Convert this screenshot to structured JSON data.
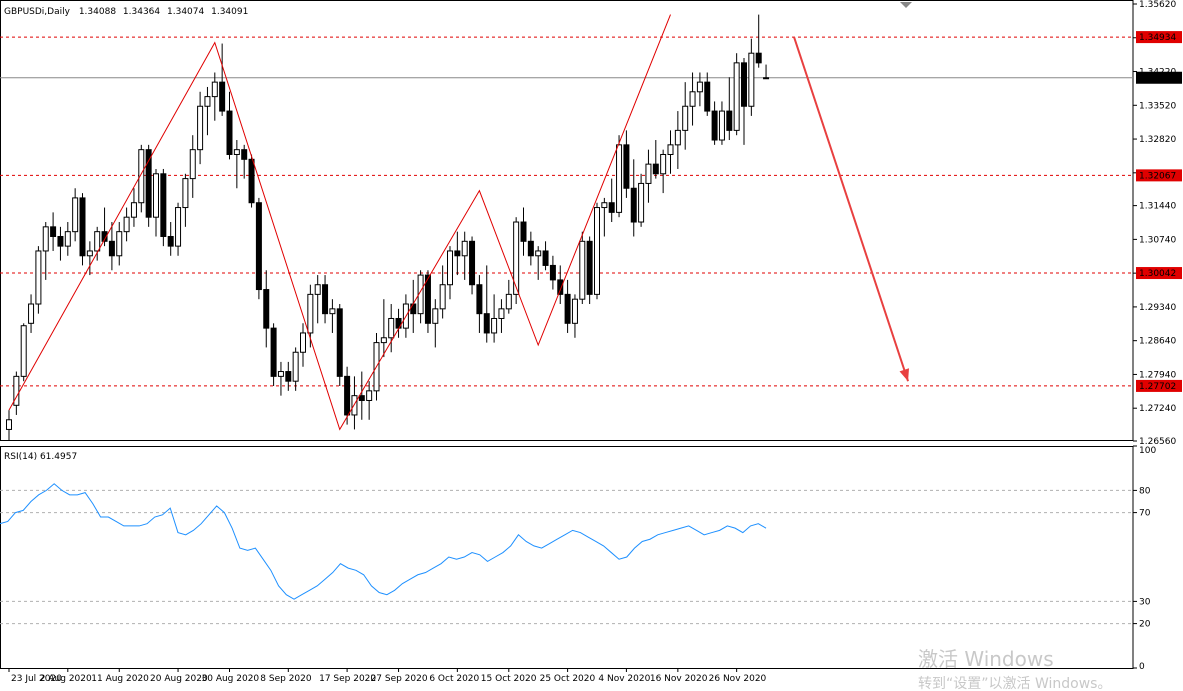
{
  "header": {
    "symbol": "GBPUSDi,Daily",
    "open": "1.34088",
    "high": "1.34364",
    "low": "1.34074",
    "close": "1.34091"
  },
  "rsi_panel": {
    "label": "RSI(14) 61.4957"
  },
  "watermark": {
    "line1": "激活 Windows",
    "line2": "转到“设置”以激活 Windows。"
  },
  "colors": {
    "bull": "#ffffff",
    "bear": "#000000",
    "level_line": "#e00000",
    "zigzag": "#e00000",
    "arrow": "#e84040",
    "rsi": "#1e90ff",
    "current_price_bg": "#000000",
    "level_bg": "#e00000"
  },
  "chart_data": [
    {
      "type": "candlestick",
      "title": "GBPUSDi,Daily",
      "ylim": [
        1.2656,
        1.3562
      ],
      "y_ticks": [
        "1.35620",
        "1.34920",
        "1.34220",
        "1.33520",
        "1.32820",
        "1.32120",
        "1.31440",
        "1.30740",
        "1.30040",
        "1.29340",
        "1.28640",
        "1.27940",
        "1.27240",
        "1.26560"
      ],
      "x_ticks": [
        "23 Jul 2020",
        "2 Aug 2020",
        "11 Aug 2020",
        "20 Aug 2020",
        "30 Aug 2020",
        "8 Sep 2020",
        "17 Sep 2020",
        "27 Sep 2020",
        "6 Oct 2020",
        "15 Oct 2020",
        "25 Oct 2020",
        "4 Nov 2020",
        "16 Nov 2020",
        "26 Nov 2020"
      ],
      "levels": [
        {
          "label": "1.34934",
          "value": 1.34934
        },
        {
          "label": "1.32067",
          "value": 1.32067
        },
        {
          "label": "1.30042",
          "value": 1.30042
        },
        {
          "label": "1.27702",
          "value": 1.27702
        }
      ],
      "current_price": {
        "label": "1.34091",
        "value": 1.34091
      },
      "candles": [
        [
          1.268,
          1.272,
          1.2656,
          1.27
        ],
        [
          1.273,
          1.28,
          1.271,
          1.279
        ],
        [
          1.279,
          1.29,
          1.278,
          1.2895
        ],
        [
          1.29,
          1.296,
          1.288,
          1.294
        ],
        [
          1.294,
          1.306,
          1.292,
          1.305
        ],
        [
          1.305,
          1.311,
          1.299,
          1.31
        ],
        [
          1.31,
          1.313,
          1.305,
          1.308
        ],
        [
          1.308,
          1.31,
          1.303,
          1.306
        ],
        [
          1.306,
          1.311,
          1.304,
          1.309
        ],
        [
          1.309,
          1.318,
          1.307,
          1.316
        ],
        [
          1.316,
          1.317,
          1.302,
          1.304
        ],
        [
          1.304,
          1.307,
          1.3,
          1.305
        ],
        [
          1.305,
          1.31,
          1.303,
          1.309
        ],
        [
          1.309,
          1.314,
          1.306,
          1.307
        ],
        [
          1.307,
          1.311,
          1.301,
          1.304
        ],
        [
          1.304,
          1.311,
          1.302,
          1.309
        ],
        [
          1.309,
          1.314,
          1.307,
          1.312
        ],
        [
          1.312,
          1.318,
          1.31,
          1.315
        ],
        [
          1.315,
          1.327,
          1.313,
          1.326
        ],
        [
          1.326,
          1.327,
          1.31,
          1.312
        ],
        [
          1.312,
          1.322,
          1.308,
          1.321
        ],
        [
          1.321,
          1.322,
          1.306,
          1.308
        ],
        [
          1.308,
          1.311,
          1.304,
          1.306
        ],
        [
          1.306,
          1.315,
          1.304,
          1.314
        ],
        [
          1.314,
          1.321,
          1.31,
          1.32
        ],
        [
          1.32,
          1.329,
          1.316,
          1.326
        ],
        [
          1.326,
          1.338,
          1.323,
          1.335
        ],
        [
          1.335,
          1.339,
          1.329,
          1.337
        ],
        [
          1.337,
          1.342,
          1.332,
          1.34
        ],
        [
          1.34,
          1.348,
          1.333,
          1.334
        ],
        [
          1.334,
          1.338,
          1.324,
          1.325
        ],
        [
          1.325,
          1.328,
          1.318,
          1.326
        ],
        [
          1.326,
          1.327,
          1.32,
          1.324
        ],
        [
          1.324,
          1.325,
          1.314,
          1.315
        ],
        [
          1.315,
          1.316,
          1.295,
          1.297
        ],
        [
          1.297,
          1.301,
          1.285,
          1.289
        ],
        [
          1.289,
          1.29,
          1.277,
          1.279
        ],
        [
          1.279,
          1.282,
          1.275,
          1.28
        ],
        [
          1.28,
          1.282,
          1.276,
          1.278
        ],
        [
          1.278,
          1.285,
          1.276,
          1.284
        ],
        [
          1.284,
          1.29,
          1.281,
          1.288
        ],
        [
          1.288,
          1.298,
          1.285,
          1.296
        ],
        [
          1.296,
          1.3,
          1.29,
          1.298
        ],
        [
          1.298,
          1.3,
          1.29,
          1.292
        ],
        [
          1.292,
          1.295,
          1.288,
          1.293
        ],
        [
          1.293,
          1.294,
          1.277,
          1.279
        ],
        [
          1.279,
          1.281,
          1.269,
          1.271
        ],
        [
          1.271,
          1.279,
          1.268,
          1.275
        ],
        [
          1.275,
          1.28,
          1.27,
          1.274
        ],
        [
          1.274,
          1.278,
          1.27,
          1.276
        ],
        [
          1.276,
          1.288,
          1.274,
          1.286
        ],
        [
          1.286,
          1.295,
          1.283,
          1.287
        ],
        [
          1.287,
          1.294,
          1.284,
          1.291
        ],
        [
          1.291,
          1.293,
          1.287,
          1.289
        ],
        [
          1.289,
          1.296,
          1.287,
          1.294
        ],
        [
          1.294,
          1.299,
          1.288,
          1.292
        ],
        [
          1.292,
          1.301,
          1.29,
          1.3
        ],
        [
          1.3,
          1.301,
          1.288,
          1.29
        ],
        [
          1.29,
          1.295,
          1.285,
          1.293
        ],
        [
          1.293,
          1.302,
          1.291,
          1.298
        ],
        [
          1.298,
          1.306,
          1.295,
          1.305
        ],
        [
          1.305,
          1.309,
          1.3,
          1.304
        ],
        [
          1.304,
          1.309,
          1.299,
          1.307
        ],
        [
          1.307,
          1.308,
          1.296,
          1.298
        ],
        [
          1.298,
          1.3,
          1.288,
          1.292
        ],
        [
          1.292,
          1.302,
          1.286,
          1.288
        ],
        [
          1.288,
          1.296,
          1.286,
          1.291
        ],
        [
          1.291,
          1.295,
          1.288,
          1.293
        ],
        [
          1.293,
          1.299,
          1.292,
          1.296
        ],
        [
          1.296,
          1.312,
          1.294,
          1.311
        ],
        [
          1.311,
          1.314,
          1.304,
          1.307
        ],
        [
          1.307,
          1.309,
          1.302,
          1.304
        ],
        [
          1.304,
          1.306,
          1.299,
          1.305
        ],
        [
          1.305,
          1.307,
          1.301,
          1.302
        ],
        [
          1.302,
          1.304,
          1.297,
          1.299
        ],
        [
          1.299,
          1.302,
          1.294,
          1.296
        ],
        [
          1.296,
          1.299,
          1.288,
          1.29
        ],
        [
          1.29,
          1.296,
          1.287,
          1.295
        ],
        [
          1.295,
          1.309,
          1.294,
          1.307
        ],
        [
          1.307,
          1.308,
          1.294,
          1.296
        ],
        [
          1.296,
          1.315,
          1.295,
          1.314
        ],
        [
          1.314,
          1.316,
          1.308,
          1.315
        ],
        [
          1.315,
          1.32,
          1.311,
          1.313
        ],
        [
          1.313,
          1.329,
          1.312,
          1.327
        ],
        [
          1.327,
          1.33,
          1.316,
          1.318
        ],
        [
          1.318,
          1.324,
          1.308,
          1.311
        ],
        [
          1.311,
          1.321,
          1.31,
          1.319
        ],
        [
          1.319,
          1.326,
          1.315,
          1.323
        ],
        [
          1.323,
          1.328,
          1.32,
          1.321
        ],
        [
          1.321,
          1.326,
          1.317,
          1.325
        ],
        [
          1.325,
          1.33,
          1.321,
          1.327
        ],
        [
          1.327,
          1.334,
          1.322,
          1.33
        ],
        [
          1.33,
          1.34,
          1.326,
          1.335
        ],
        [
          1.335,
          1.342,
          1.331,
          1.338
        ],
        [
          1.338,
          1.342,
          1.335,
          1.34
        ],
        [
          1.34,
          1.342,
          1.333,
          1.334
        ],
        [
          1.334,
          1.336,
          1.327,
          1.328
        ],
        [
          1.328,
          1.336,
          1.327,
          1.334
        ],
        [
          1.334,
          1.341,
          1.328,
          1.33
        ],
        [
          1.33,
          1.346,
          1.329,
          1.344
        ],
        [
          1.344,
          1.345,
          1.327,
          1.335
        ],
        [
          1.335,
          1.349,
          1.333,
          1.346
        ],
        [
          1.346,
          1.354,
          1.343,
          1.344
        ],
        [
          1.34088,
          1.34364,
          1.34074,
          1.34091
        ]
      ],
      "zigzag": [
        [
          0,
          1.272
        ],
        [
          28,
          1.3482
        ],
        [
          45,
          1.268
        ],
        [
          64,
          1.3175
        ],
        [
          72,
          1.2855
        ],
        [
          90,
          1.354
        ]
      ],
      "forecast_arrow": {
        "from": 1.34934,
        "to": 1.278
      }
    },
    {
      "type": "line",
      "title": "RSI(14) 61.4957",
      "ylim": [
        0,
        100
      ],
      "y_ticks": [
        "100",
        "80",
        "70",
        "30",
        "20",
        "0"
      ],
      "levels": [
        80,
        70,
        30,
        20
      ],
      "series": [
        {
          "values": [
            65,
            66,
            70,
            71,
            75,
            78,
            80,
            83,
            80,
            78,
            78,
            79,
            74,
            68,
            68,
            66,
            64,
            64,
            64,
            65,
            68,
            69,
            72,
            61,
            60,
            62,
            65,
            69,
            73,
            70,
            63,
            54,
            53,
            54,
            49,
            44,
            37,
            33,
            31,
            33,
            35,
            37,
            40,
            43,
            47,
            45,
            44,
            42,
            37,
            34,
            33,
            35,
            38,
            40,
            42,
            43,
            45,
            47,
            50,
            49,
            50,
            52,
            51,
            48,
            50,
            52,
            55,
            60,
            57,
            55,
            54,
            56,
            58,
            60,
            62,
            61,
            59,
            57,
            55,
            52,
            49,
            50,
            54,
            57,
            58,
            60,
            61,
            62,
            63,
            64,
            62,
            60,
            61,
            62,
            64,
            63,
            61,
            64,
            65,
            63
          ]
        }
      ]
    }
  ]
}
